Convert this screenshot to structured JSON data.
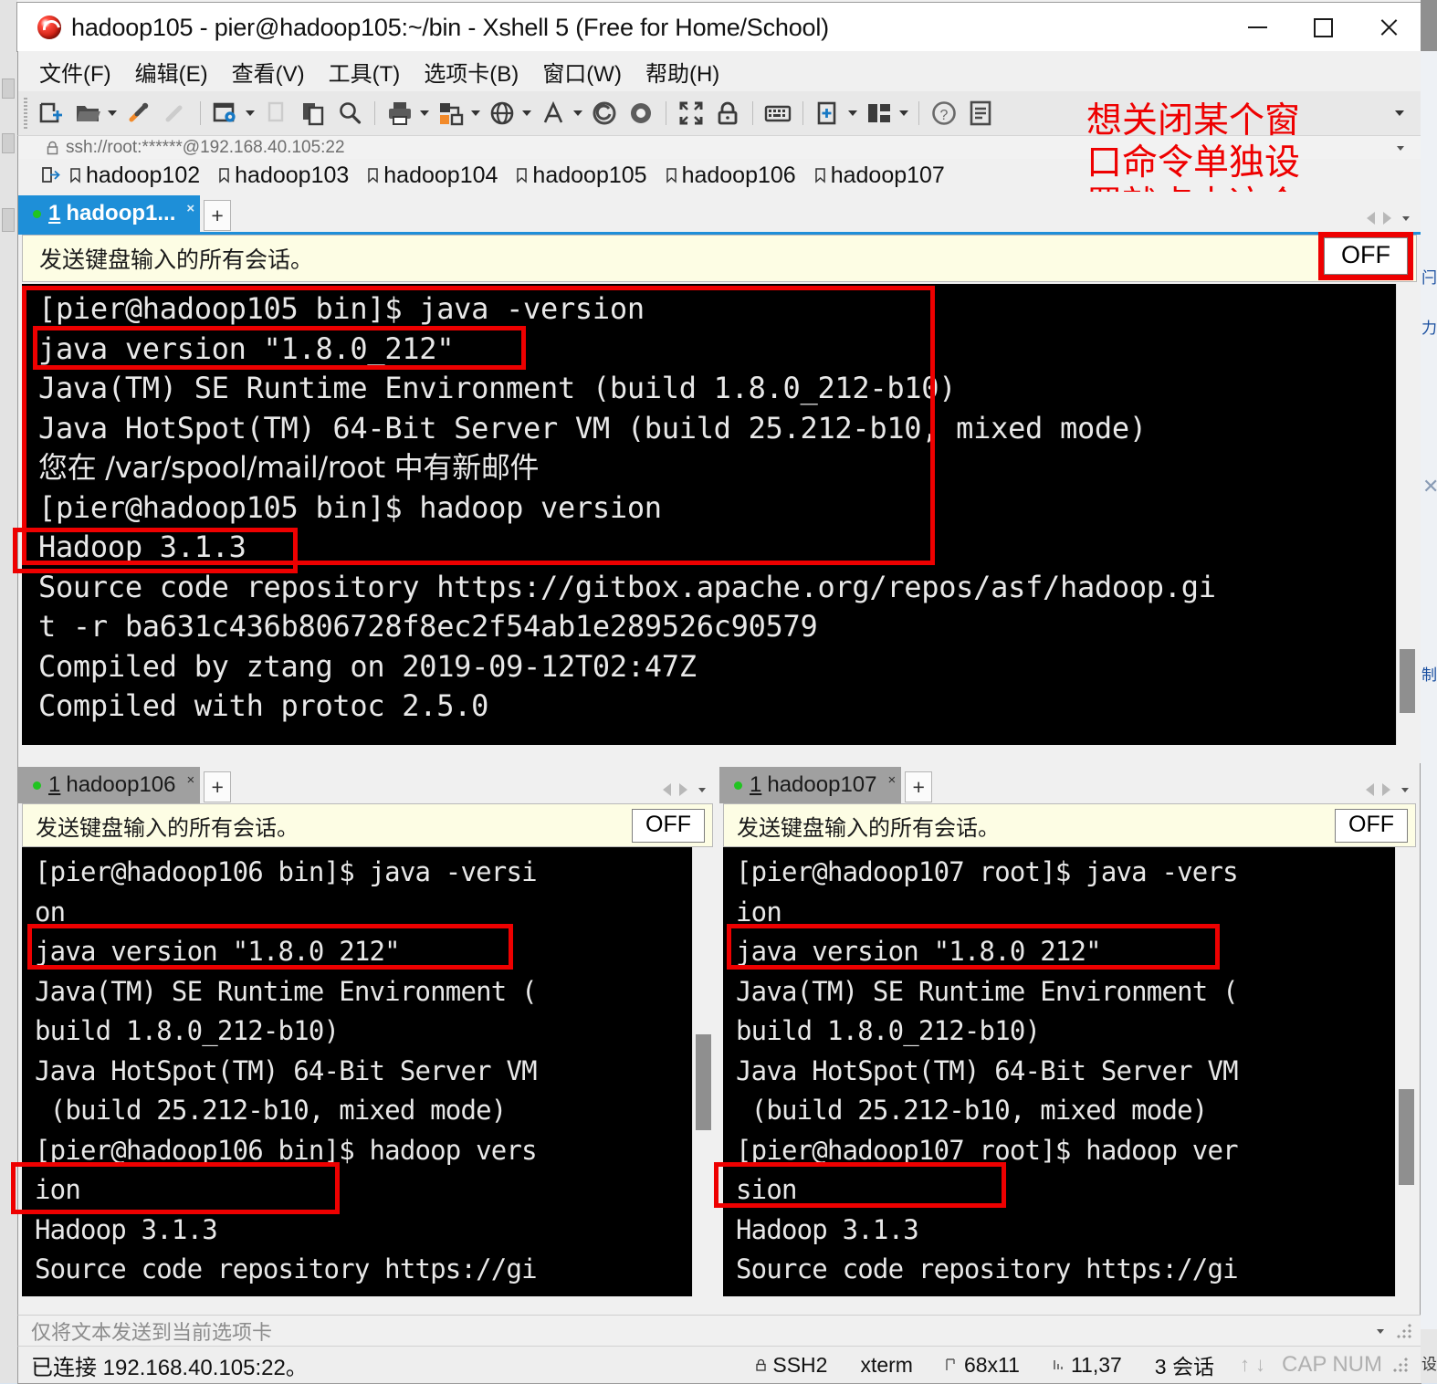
{
  "window": {
    "title": "hadoop105 - pier@hadoop105:~/bin - Xshell 5 (Free for Home/School)",
    "minimize": "—",
    "maximize": "□",
    "close": "✕"
  },
  "menu": [
    {
      "label": "文件(F)"
    },
    {
      "label": "编辑(E)"
    },
    {
      "label": "查看(V)"
    },
    {
      "label": "工具(T)"
    },
    {
      "label": "选项卡(B)"
    },
    {
      "label": "窗口(W)"
    },
    {
      "label": "帮助(H)"
    }
  ],
  "address": {
    "value": "ssh://root:******@192.168.40.105:22"
  },
  "session_bar": {
    "items": [
      "hadoop102",
      "hadoop103",
      "hadoop104",
      "hadoop105",
      "hadoop106",
      "hadoop107"
    ]
  },
  "annotation": {
    "line1": "想关闭某个窗",
    "line2": "口命令单独设",
    "line3": "置就点击这个"
  },
  "panes": {
    "top": {
      "tab": {
        "num": "1",
        "label": "hadoop1...",
        "close": "×"
      },
      "add_tab": "+",
      "notice": "发送键盘输入的所有会话。",
      "off_label": "OFF",
      "terminal": [
        "[pier@hadoop105 bin]$ java -version",
        "java version \"1.8.0_212\"",
        "Java(TM) SE Runtime Environment (build 1.8.0_212-b10)",
        "Java HotSpot(TM) 64-Bit Server VM (build 25.212-b10, mixed mode)",
        "您在 /var/spool/mail/root 中有新邮件",
        "[pier@hadoop105 bin]$ hadoop version",
        "Hadoop 3.1.3",
        "Source code repository https://gitbox.apache.org/repos/asf/hadoop.gi",
        "t -r ba631c436b806728f8ec2f54ab1e289526c90579",
        "Compiled by ztang on 2019-09-12T02:47Z",
        "Compiled with protoc 2.5.0"
      ]
    },
    "bottom_left": {
      "tab": {
        "num": "1",
        "label": "hadoop106",
        "close": "×"
      },
      "add_tab": "+",
      "notice": "发送键盘输入的所有会话。",
      "off_label": "OFF",
      "terminal": [
        "[pier@hadoop106 bin]$ java -versi",
        "on",
        "java version \"1.8.0_212\"",
        "Java(TM) SE Runtime Environment (",
        "build 1.8.0_212-b10)",
        "Java HotSpot(TM) 64-Bit Server VM",
        " (build 25.212-b10, mixed mode)",
        "[pier@hadoop106 bin]$ hadoop vers",
        "ion",
        "Hadoop 3.1.3",
        "Source code repository https://gi"
      ]
    },
    "bottom_right": {
      "tab": {
        "num": "1",
        "label": "hadoop107",
        "close": "×"
      },
      "add_tab": "+",
      "notice": "发送键盘输入的所有会话。",
      "off_label": "OFF",
      "terminal": [
        "[pier@hadoop107 root]$ java -vers",
        "ion",
        "java version \"1.8.0_212\"",
        "Java(TM) SE Runtime Environment (",
        "build 1.8.0_212-b10)",
        "Java HotSpot(TM) 64-Bit Server VM",
        " (build 25.212-b10, mixed mode)",
        "[pier@hadoop107 root]$ hadoop ver",
        "sion",
        "Hadoop 3.1.3",
        "Source code repository https://gi"
      ]
    }
  },
  "status": {
    "hint": "仅将文本发送到当前选项卡",
    "connected": "已连接 192.168.40.105:22。",
    "protocol": "SSH2",
    "term_type": "xterm",
    "size": "68x11",
    "cursor": "11,37",
    "sessions": "3 会话",
    "caps": "CAP",
    "num": "NUM"
  },
  "colors": {
    "accent": "#1e8fd8",
    "annotation_red": "#ee0000",
    "notice_bg": "#fdfde4",
    "terminal_bg": "#000000",
    "terminal_fg": "#e8e8e8"
  }
}
